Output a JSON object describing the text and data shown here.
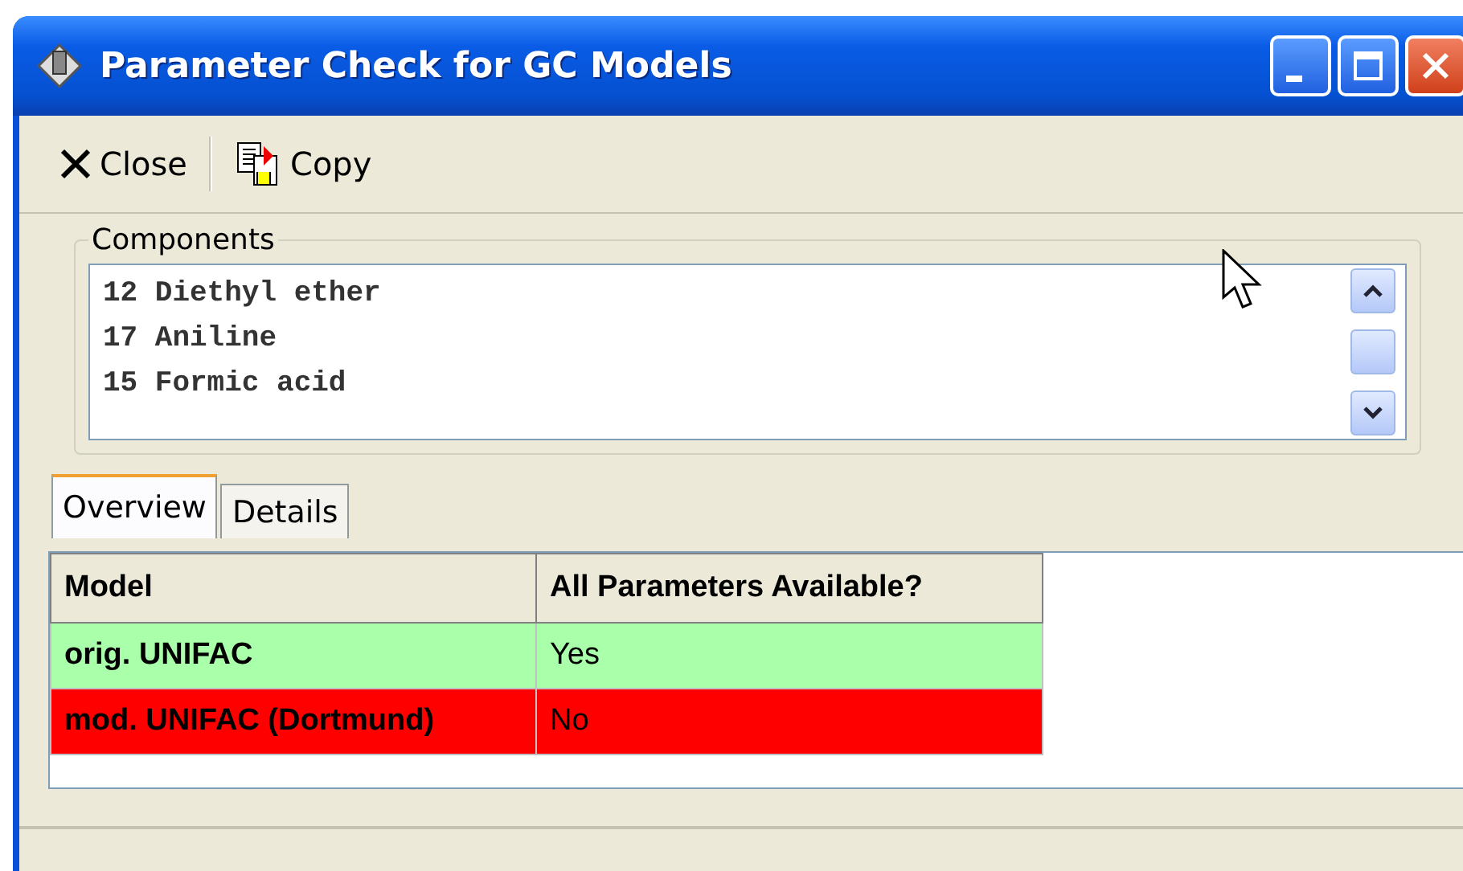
{
  "window": {
    "title": "Parameter Check for GC Models"
  },
  "toolbar": [
    {
      "kind": "close",
      "label": "Close"
    },
    {
      "kind": "copy",
      "label": "Copy"
    }
  ],
  "components": {
    "label": "Components",
    "items": [
      "12 Diethyl ether",
      "17 Aniline",
      "15 Formic acid"
    ]
  },
  "tabs": [
    {
      "label": "Overview",
      "selected": true
    },
    {
      "label": "Details",
      "selected": false
    }
  ],
  "table": {
    "columns": [
      "Model",
      "All Parameters Available?"
    ],
    "rows": [
      {
        "model": "orig. UNIFAC",
        "available": "Yes",
        "color": "#aaffaa"
      },
      {
        "model": "mod. UNIFAC (Dortmund)",
        "available": "No",
        "color": "#ff0000"
      }
    ]
  }
}
